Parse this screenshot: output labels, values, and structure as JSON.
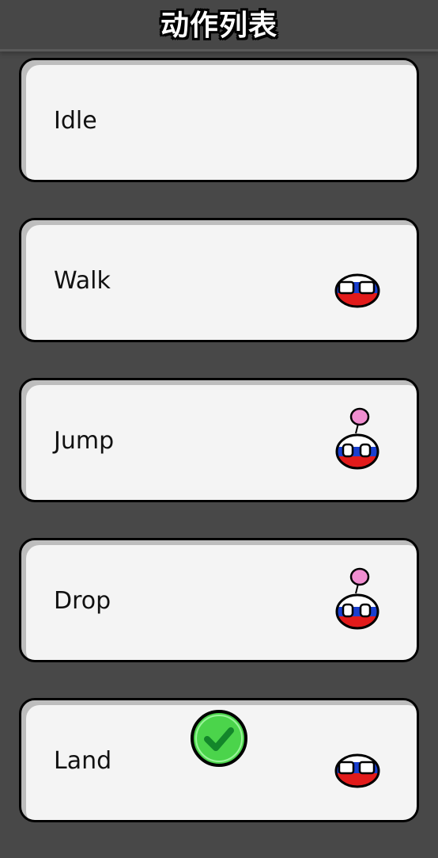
{
  "header": {
    "title": "动作列表"
  },
  "actions": [
    {
      "label": "Idle",
      "icon": "none"
    },
    {
      "label": "Walk",
      "icon": "russia-ball-icon"
    },
    {
      "label": "Jump",
      "icon": "russia-ball-balloon-icon"
    },
    {
      "label": "Drop",
      "icon": "russia-ball-balloon-icon"
    },
    {
      "label": "Land",
      "icon": "russia-ball-icon"
    }
  ],
  "colors": {
    "background": "#484848",
    "card": "#f4f4f4",
    "check_green": "#4bd44b"
  },
  "check_icon": "checkmark-icon"
}
